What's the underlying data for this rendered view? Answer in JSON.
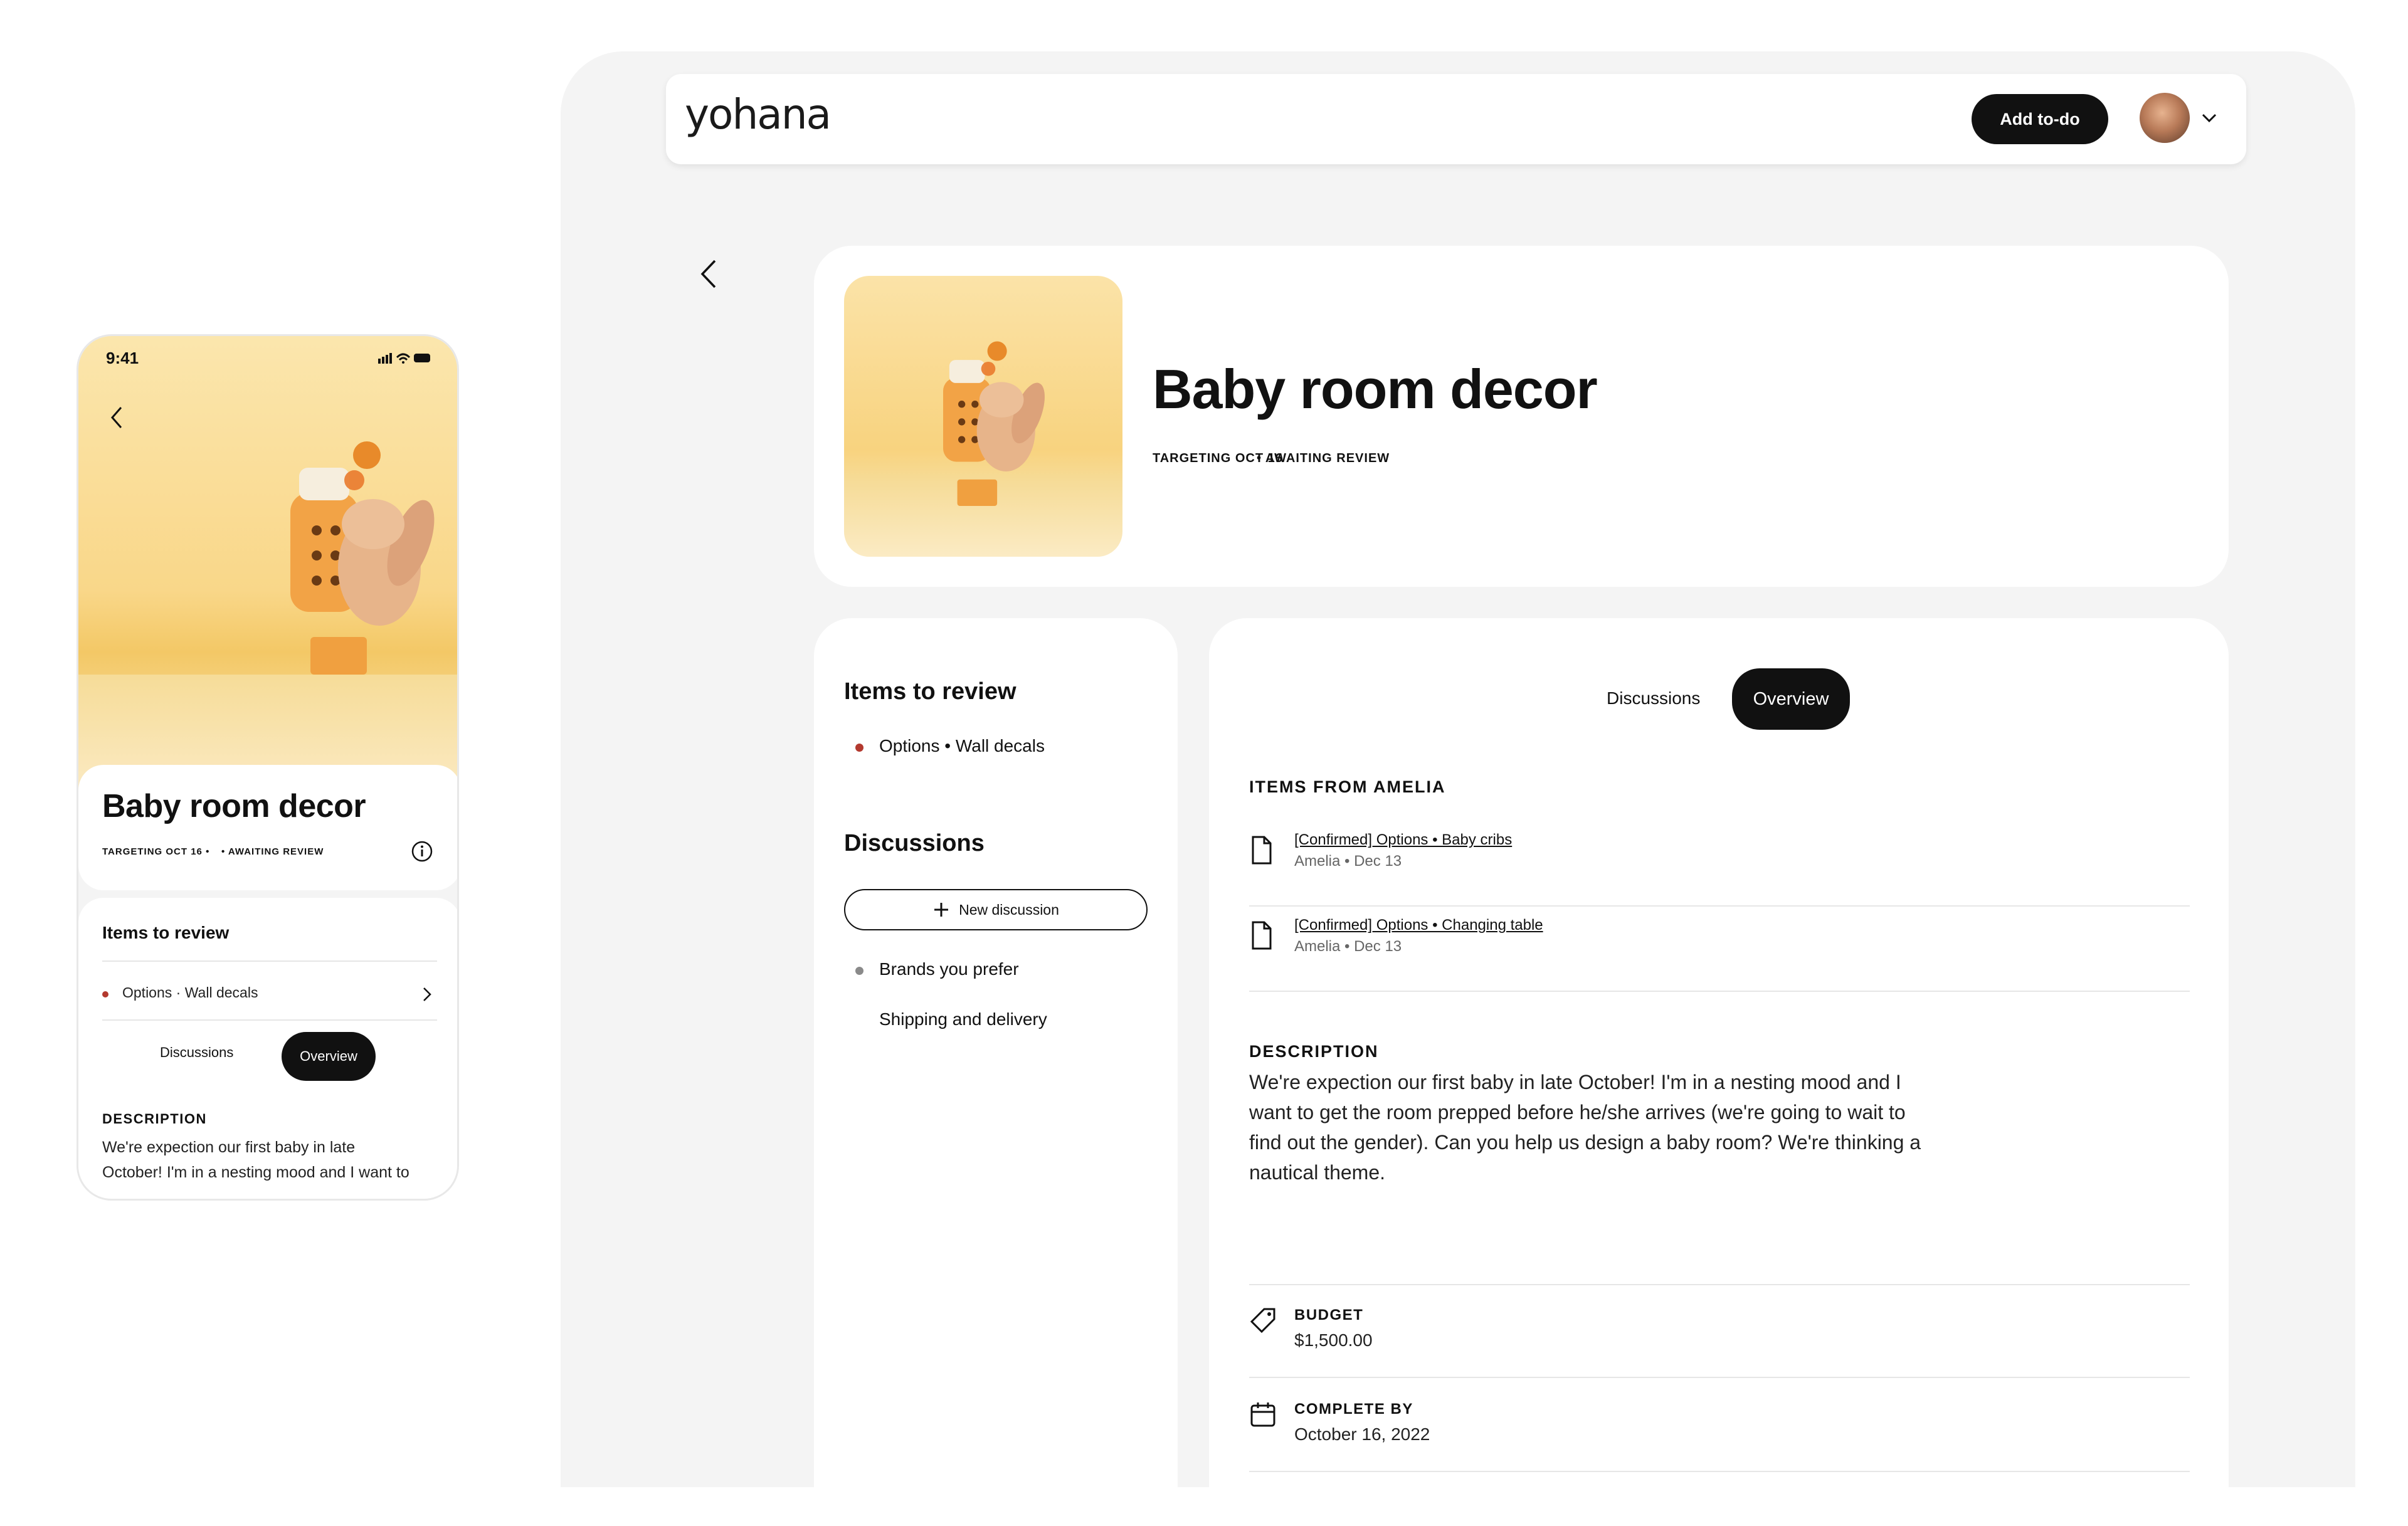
{
  "phone": {
    "time": "9:41",
    "title": "Baby room decor",
    "meta_target": "TARGETING OCT 16 •",
    "meta_status": "• AWAITING REVIEW",
    "items_heading": "Items to review",
    "review_item": "Options · Wall decals",
    "tab_discussions": "Discussions",
    "tab_overview": "Overview",
    "description_heading": "DESCRIPTION",
    "description_line1": "We're expection our first baby in late",
    "description_line2": "October! I'm in a nesting mood and I want to"
  },
  "header": {
    "logo": "yohana",
    "add_todo": "Add to-do"
  },
  "project": {
    "title": "Baby room decor",
    "meta_target": "TARGETING OCT 16",
    "meta_status": "• AWAITING REVIEW"
  },
  "sidebar": {
    "items_heading": "Items to review",
    "review_items": [
      "Options • Wall decals"
    ],
    "discussions_heading": "Discussions",
    "new_discussion": "New discussion",
    "discussions": [
      "Brands you prefer",
      "Shipping and delivery"
    ]
  },
  "main": {
    "tabs": [
      "Discussions",
      "Overview"
    ],
    "active_tab": "Overview",
    "items_heading": "ITEMS FROM AMELIA",
    "items": [
      {
        "title": "[Confirmed] Options • Baby cribs",
        "meta": "Amelia • Dec 13"
      },
      {
        "title": "[Confirmed] Options • Changing table",
        "meta": "Amelia • Dec 13"
      }
    ],
    "description_heading": "DESCRIPTION",
    "description_lines": [
      "We're expection our first baby in late October! I'm in a nesting mood and I",
      "want to get the room prepped before he/she arrives (we're going to wait to",
      "find out the gender). Can you help us design a baby room? We're thinking  a",
      "nautical theme."
    ],
    "budget_label": "BUDGET",
    "budget_value": "$1,500.00",
    "complete_label": "COMPLETE BY",
    "complete_value": "October 16, 2022"
  },
  "colors": {
    "accent_dark": "#111111",
    "status_dot_red": "#b3392f",
    "status_dot_grey": "#8a8a8a",
    "hero_yellow": "#f9d789"
  },
  "icons": [
    "back-chevron-icon",
    "chevron-down-icon",
    "info-icon",
    "chevron-right-icon",
    "plus-icon",
    "document-icon",
    "tag-icon",
    "calendar-icon",
    "signal-icon",
    "wifi-icon",
    "battery-icon"
  ]
}
